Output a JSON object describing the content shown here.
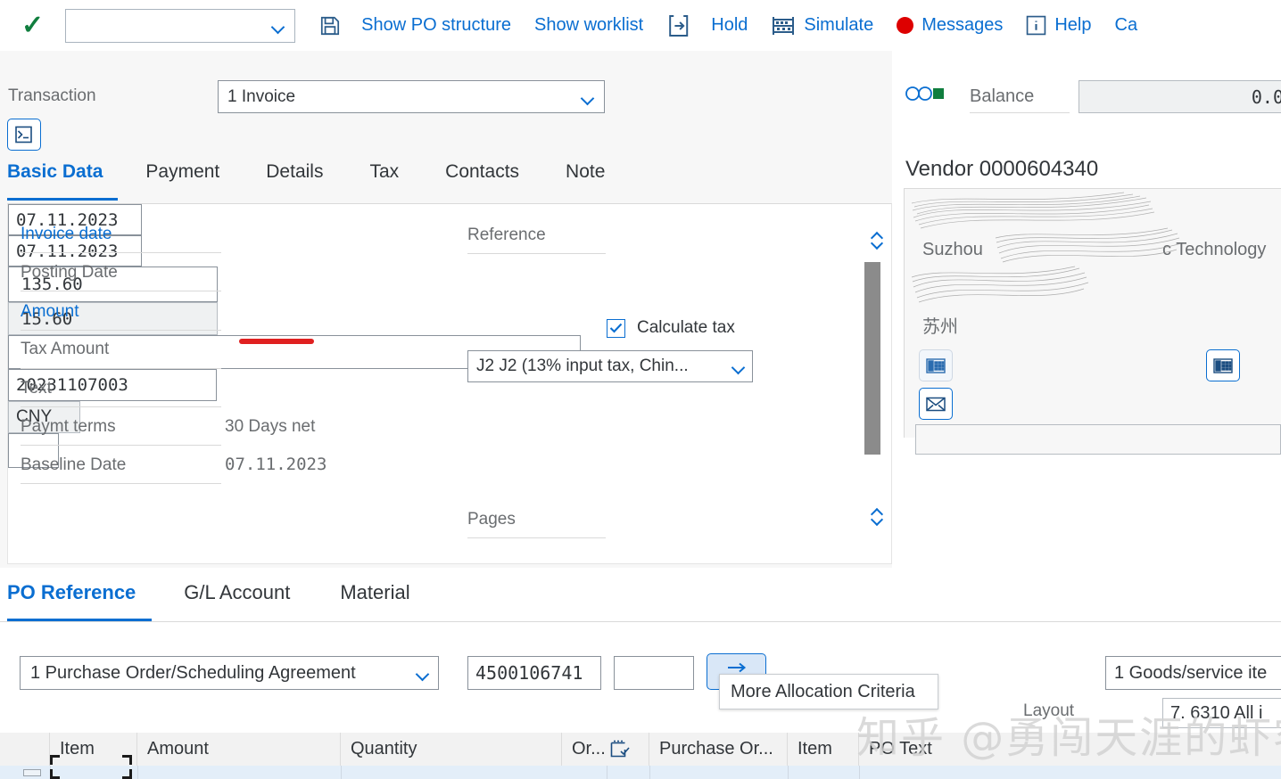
{
  "toolbar": {
    "confirm_icon": "check-icon",
    "dropdown_value": "",
    "save_icon": "save-icon",
    "items": [
      {
        "label": "Show PO structure",
        "icon": ""
      },
      {
        "label": "Show worklist",
        "icon": ""
      },
      {
        "label": "",
        "icon": "export-icon"
      },
      {
        "label": "Hold",
        "icon": ""
      },
      {
        "label": "Simulate",
        "icon": "abacus-icon"
      },
      {
        "label": "Messages",
        "icon": "red-dot-icon"
      },
      {
        "label": "Help",
        "icon": "info-icon"
      },
      {
        "label": "Ca",
        "icon": ""
      }
    ]
  },
  "transaction": {
    "label": "Transaction",
    "value": "1 Invoice"
  },
  "balance": {
    "label": "Balance",
    "value": "0.0",
    "indicator": "traffic-light-green"
  },
  "tabs": [
    {
      "label": "Basic Data",
      "active": true
    },
    {
      "label": "Payment",
      "active": false
    },
    {
      "label": "Details",
      "active": false
    },
    {
      "label": "Tax",
      "active": false
    },
    {
      "label": "Contacts",
      "active": false
    },
    {
      "label": "Note",
      "active": false
    }
  ],
  "basic_data": {
    "invoice_date": {
      "label": "Invoice date",
      "value": "07.11.2023"
    },
    "posting_date": {
      "label": "Posting Date",
      "value": "07.11.2023"
    },
    "amount": {
      "label": "Amount",
      "value": "135.60"
    },
    "tax_amount": {
      "label": "Tax Amount",
      "value": "15.60"
    },
    "text": {
      "label": "Text",
      "value": ""
    },
    "paymt_terms": {
      "label": "Paymt terms",
      "value": "30 Days net"
    },
    "baseline_date": {
      "label": "Baseline Date",
      "value": "07.11.2023"
    },
    "reference": {
      "label": "Reference",
      "value": "20231107003"
    },
    "currency": {
      "value": "CNY"
    },
    "calculate_tax": {
      "label": "Calculate tax",
      "checked": true
    },
    "tax_code": {
      "value": "J2 J2 (13% input tax, Chin..."
    },
    "pages": {
      "label": "Pages",
      "value": ""
    }
  },
  "vendor": {
    "title": "Vendor 0000604340",
    "name_line": "Suzhou",
    "name_line_tail": "c Technology",
    "city": "苏州",
    "icons": [
      "phone-icon",
      "fax-icon",
      "email-icon"
    ]
  },
  "lower_tabs": [
    {
      "label": "PO Reference",
      "active": true
    },
    {
      "label": "G/L Account",
      "active": false
    },
    {
      "label": "Material",
      "active": false
    }
  ],
  "po_reference": {
    "doc_type": "1 Purchase Order/Scheduling Agreement",
    "po_number": "4500106741",
    "po_item": "",
    "arrow_button_icon": "arrow-right-icon",
    "tooltip": "More Allocation Criteria",
    "goods_service": "1 Goods/service ite",
    "layout_label": "Layout",
    "layout_value": "7. 6310 All i"
  },
  "table": {
    "columns": [
      "Item",
      "Amount",
      "Quantity",
      "Or...",
      "Purchase Or...",
      "Item",
      "PO Text"
    ],
    "header_icon": "checkbox-list-icon"
  },
  "watermark": "知乎 @勇闯天涯的虾客",
  "colors": {
    "accent": "#0a6ed1",
    "success": "#107e3e",
    "error": "#d00000",
    "annotation": "#e02020"
  }
}
